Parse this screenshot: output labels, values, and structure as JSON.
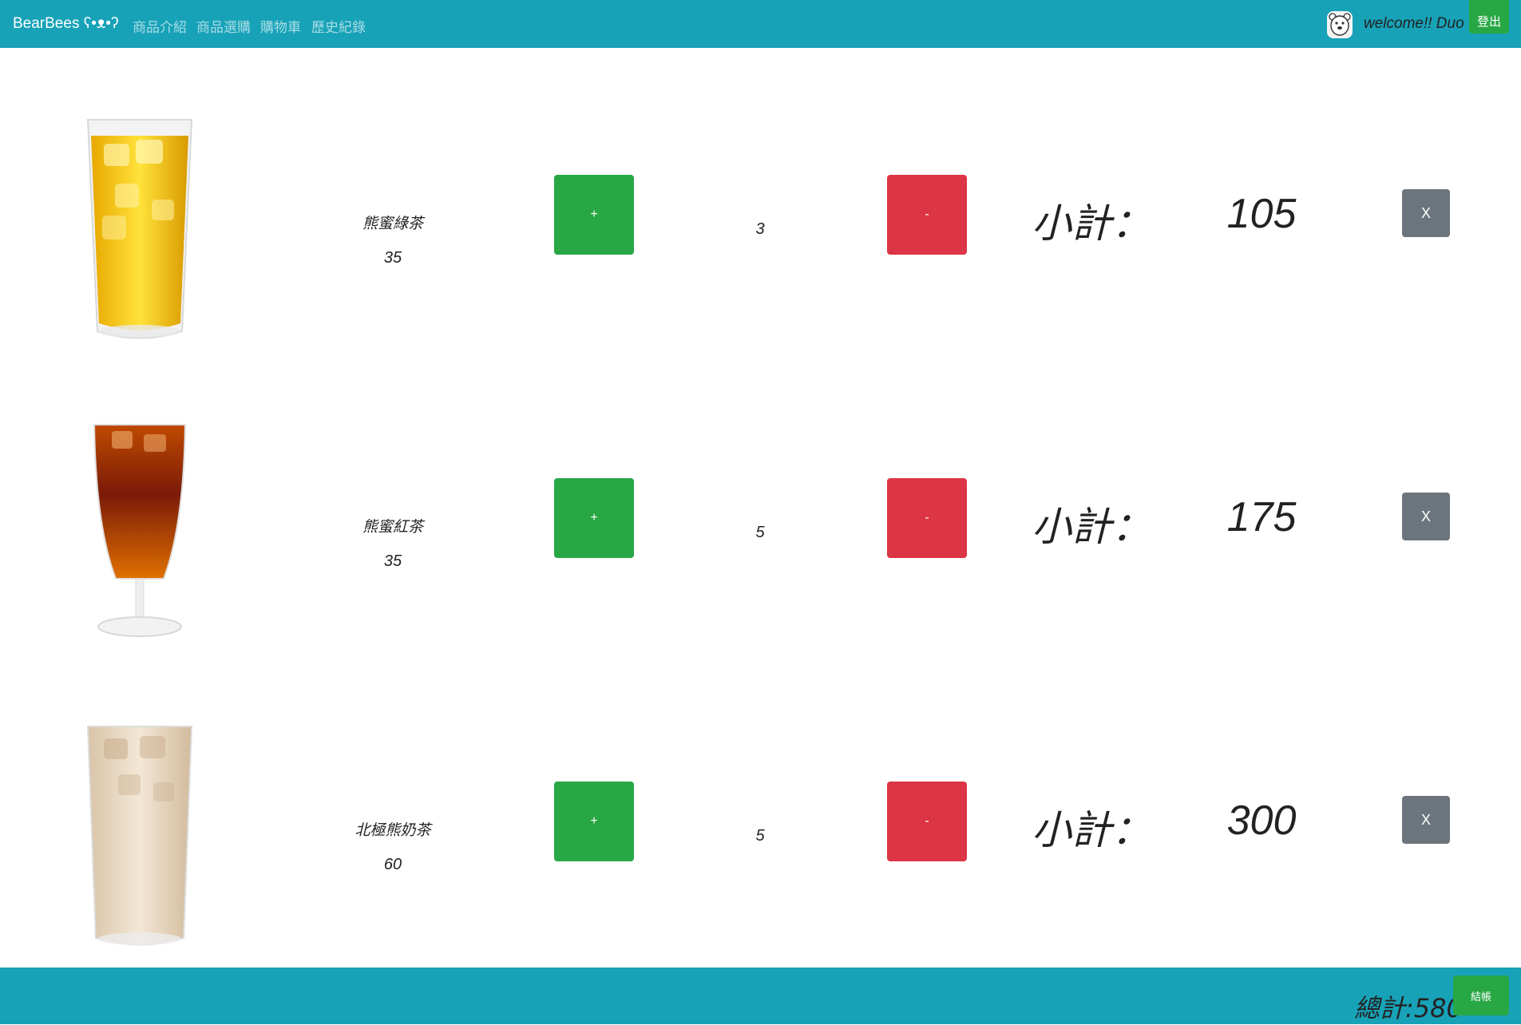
{
  "navbar": {
    "brand": "BearBees ʕ•ᴥ•ʔ",
    "links": [
      "商品介紹",
      "商品選購",
      "購物車",
      "歷史紀錄"
    ],
    "welcome": "welcome!! Duo",
    "logout_label": "登出",
    "avatar_icon": "bear-avatar-icon"
  },
  "cart": {
    "items": [
      {
        "name": "熊蜜綠茶",
        "price": "35",
        "plus_label": "+",
        "quantity": "3",
        "minus_label": "-",
        "subtotal_label": "小計：",
        "subtotal": "105",
        "remove_label": "X",
        "image_icon": "iced-green-tea-glass"
      },
      {
        "name": "熊蜜紅茶",
        "price": "35",
        "plus_label": "+",
        "quantity": "5",
        "minus_label": "-",
        "subtotal_label": "小計：",
        "subtotal": "175",
        "remove_label": "X",
        "image_icon": "iced-black-tea-glass"
      },
      {
        "name": "北極熊奶茶",
        "price": "60",
        "plus_label": "+",
        "quantity": "5",
        "minus_label": "-",
        "subtotal_label": "小計：",
        "subtotal": "300",
        "remove_label": "X",
        "image_icon": "iced-milk-tea-glass"
      }
    ]
  },
  "footer": {
    "total": "總計:580",
    "checkout_label": "結帳"
  },
  "colors": {
    "navbar": "#17a2b8",
    "success": "#28a745",
    "danger": "#dc3545",
    "secondary": "#6c757d"
  }
}
